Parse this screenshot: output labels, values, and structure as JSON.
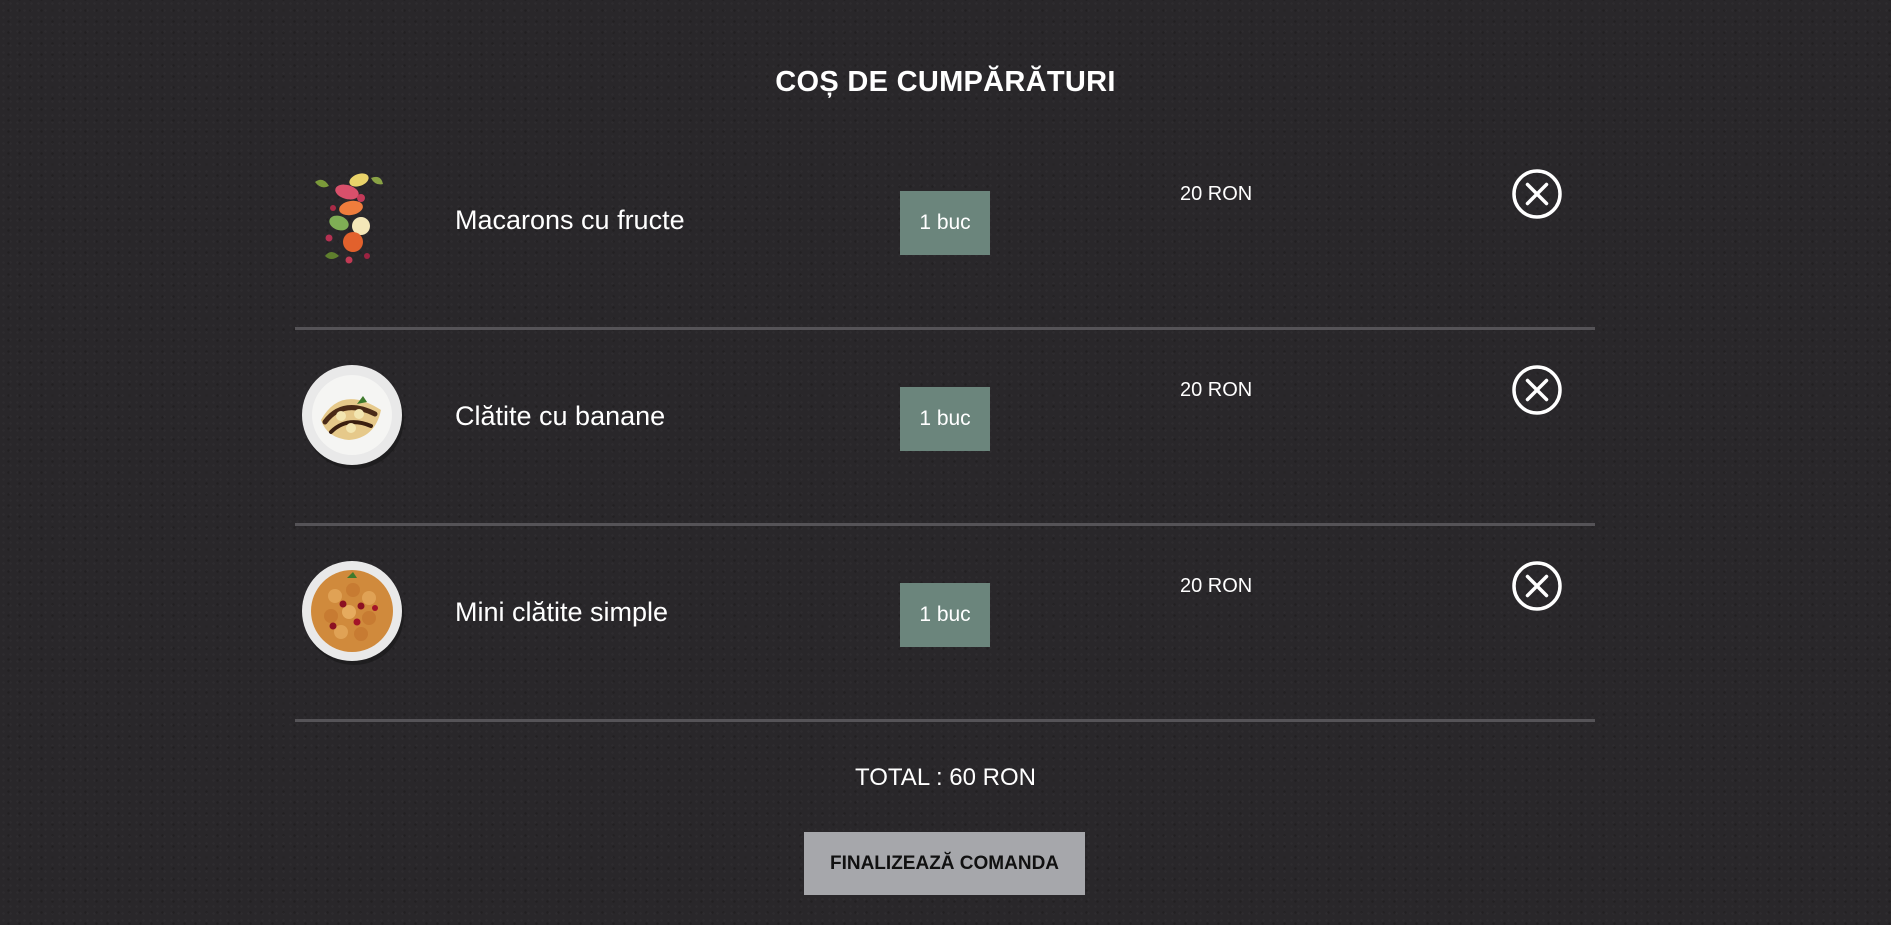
{
  "page": {
    "title": "COȘ DE CUMPĂRĂTURI"
  },
  "cart": {
    "items": [
      {
        "name": "Macarons cu fructe",
        "quantity": "1 buc",
        "price": "20 RON",
        "image": "macarons-image",
        "remove_icon": "close-circle-icon"
      },
      {
        "name": "Clătite cu banane",
        "quantity": "1 buc",
        "price": "20 RON",
        "image": "banana-crepes-image",
        "remove_icon": "close-circle-icon"
      },
      {
        "name": "Mini clătite simple",
        "quantity": "1 buc",
        "price": "20 RON",
        "image": "mini-pancakes-image",
        "remove_icon": "close-circle-icon"
      }
    ],
    "total": "TOTAL : 60 RON",
    "checkout_label": "FINALIZEAZĂ COMANDA"
  },
  "colors": {
    "background": "#29272a",
    "quantity_box": "#6b857c",
    "checkout_button": "#a6a7ab",
    "divider": "#555357",
    "text": "#ffffff"
  }
}
